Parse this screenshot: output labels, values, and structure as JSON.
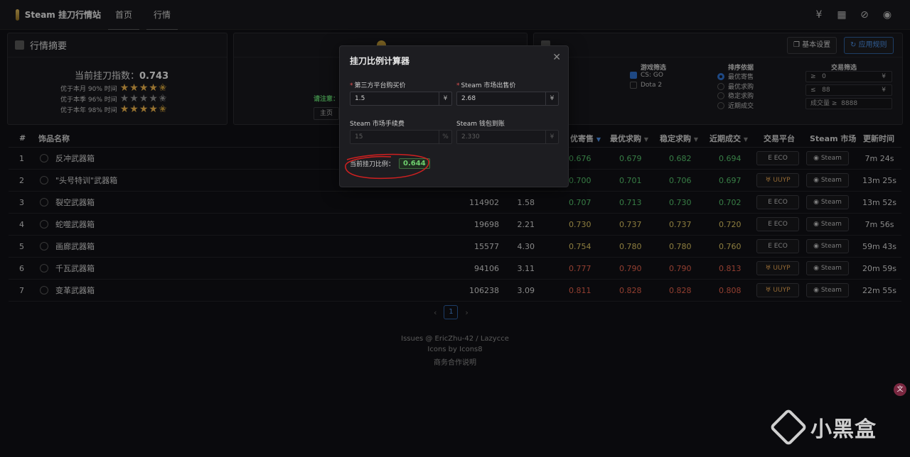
{
  "app": {
    "title": "Steam 挂刀行情站"
  },
  "nav": {
    "tabs": [
      "首页",
      "行情"
    ]
  },
  "top_icons": [
    "currency-icon",
    "calculator-icon",
    "eye-off-icon",
    "github-icon"
  ],
  "summary": {
    "title": "行情摘要",
    "index_label": "当前挂刀指数：",
    "index_value": "0.743",
    "ranks": [
      {
        "label": "优于本月 90% 时间",
        "stars": 4.5
      },
      {
        "label": "优于本季 96% 时间",
        "stars": 4.5
      },
      {
        "label": "优于本年 98% 时间",
        "stars": 4.5
      }
    ]
  },
  "market_panel": {
    "note": "请注意：",
    "button": "主页"
  },
  "filters": {
    "basic_settings_button": "基本设置",
    "apply_button": "应用规则",
    "game_title": "游戏筛选",
    "games": [
      {
        "label": "CS: GO",
        "checked": true
      },
      {
        "label": "Dota 2",
        "checked": false
      }
    ],
    "sort_title": "排序依据",
    "sorts": [
      {
        "label": "最优寄售",
        "on": true
      },
      {
        "label": "最优求购",
        "on": false
      },
      {
        "label": "稳定求购",
        "on": false
      },
      {
        "label": "近期成交",
        "on": false
      }
    ],
    "trade_title": "交易筛选",
    "min_prefix": "≥",
    "min_value": "0",
    "min_unit": "¥",
    "max_prefix": "≤",
    "max_value": "88",
    "max_unit": "¥",
    "volume_label": "成交量 ≥",
    "volume_value": "8888"
  },
  "table": {
    "headers": {
      "idx": "#",
      "name": "饰品名称",
      "best_sell": "优寄售",
      "best_buy": "最优求购",
      "stable_buy": "稳定求购",
      "recent": "近期成交",
      "platform": "交易平台",
      "steam": "Steam 市场",
      "updated": "更新时间"
    },
    "rows": [
      {
        "idx": "1",
        "name": "反冲武器箱",
        "volume": "",
        "price": "",
        "best_sell": "0.676",
        "best_buy": "0.679",
        "stable_buy": "0.682",
        "recent": "0.694",
        "platform": "ECO",
        "steam": "Steam",
        "updated": "7m 24s",
        "tone": "green"
      },
      {
        "idx": "2",
        "name": "\"头号特训\"武器箱",
        "volume": "",
        "price": "",
        "best_sell": "0.700",
        "best_buy": "0.701",
        "stable_buy": "0.706",
        "recent": "0.697",
        "platform": "UUYP",
        "steam": "Steam",
        "updated": "13m 25s",
        "tone": "green"
      },
      {
        "idx": "3",
        "name": "裂空武器箱",
        "volume": "114902",
        "price": "1.58",
        "best_sell": "0.707",
        "best_buy": "0.713",
        "stable_buy": "0.730",
        "recent": "0.702",
        "platform": "ECO",
        "steam": "Steam",
        "updated": "13m 52s",
        "tone": "green"
      },
      {
        "idx": "4",
        "name": "蛇噬武器箱",
        "volume": "19698",
        "price": "2.21",
        "best_sell": "0.730",
        "best_buy": "0.737",
        "stable_buy": "0.737",
        "recent": "0.720",
        "platform": "ECO",
        "steam": "Steam",
        "updated": "7m 56s",
        "tone": "yellow"
      },
      {
        "idx": "5",
        "name": "画廊武器箱",
        "volume": "15577",
        "price": "4.30",
        "best_sell": "0.754",
        "best_buy": "0.780",
        "stable_buy": "0.780",
        "recent": "0.760",
        "platform": "ECO",
        "steam": "Steam",
        "updated": "59m 43s",
        "tone": "yellow"
      },
      {
        "idx": "6",
        "name": "千瓦武器箱",
        "volume": "94106",
        "price": "3.11",
        "best_sell": "0.777",
        "best_buy": "0.790",
        "stable_buy": "0.790",
        "recent": "0.813",
        "platform": "UUYP",
        "steam": "Steam",
        "updated": "20m 59s",
        "tone": "red"
      },
      {
        "idx": "7",
        "name": "变革武器箱",
        "volume": "106238",
        "price": "3.09",
        "best_sell": "0.811",
        "best_buy": "0.828",
        "stable_buy": "0.828",
        "recent": "0.808",
        "platform": "UUYP",
        "steam": "Steam",
        "updated": "22m 55s",
        "tone": "red"
      }
    ]
  },
  "pagination": {
    "current": "1"
  },
  "footer": {
    "line1": "Issues @ EricZhu-42 / Lazycce",
    "line2": "Icons by Icons8",
    "line3": "商务合作说明"
  },
  "modal": {
    "title": "挂刀比例计算器",
    "f1_label": "第三方平台购买价",
    "f1_value": "1.5",
    "f1_unit": "¥",
    "f2_label": "Steam 市场出售价",
    "f2_value": "2.68",
    "f2_unit": "¥",
    "f3_label": "Steam 市场手续费",
    "f3_value": "15",
    "f3_unit": "%",
    "f4_label": "Steam 钱包到账",
    "f4_value": "2.330",
    "f4_unit": "¥",
    "ratio_label": "当前挂刀比例：",
    "ratio_value": "0.644"
  },
  "watermark": {
    "text": "小黑盒"
  },
  "translate_badge": "文"
}
